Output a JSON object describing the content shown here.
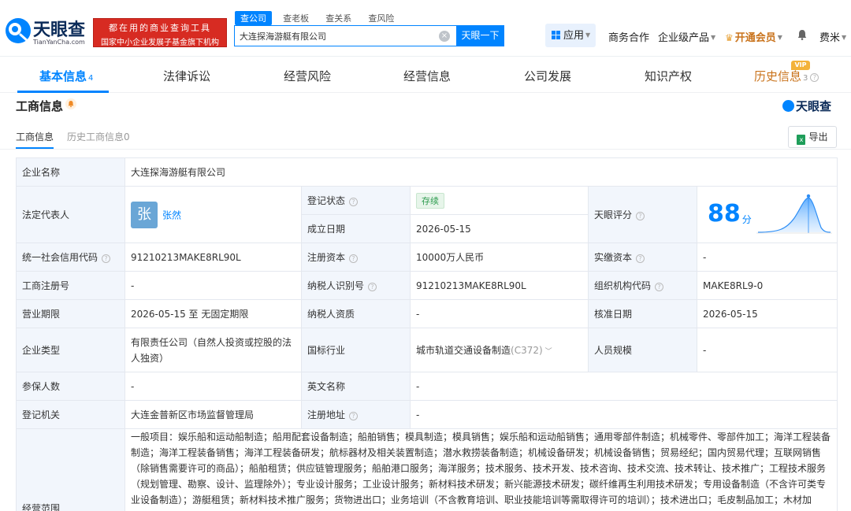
{
  "header": {
    "logo_cn": "天眼查",
    "logo_en": "TianYanCha.com",
    "ad_line1": "都在用的商业查询工具",
    "ad_line2": "国家中小企业发展子基金旗下机构",
    "search_tabs": [
      "查公司",
      "查老板",
      "查关系",
      "查风险"
    ],
    "search_value": "大连探海游艇有限公司",
    "search_button": "天眼一下",
    "app_button": "应用",
    "nav_business": "商务合作",
    "nav_enterprise": "企业级产品",
    "nav_vip": "开通会员",
    "user_name": "费米"
  },
  "main_tabs": {
    "basic": "基本信息",
    "basic_count": "4",
    "legal": "法律诉讼",
    "risk": "经营风险",
    "operation": "经营信息",
    "development": "公司发展",
    "ip": "知识产权",
    "history": "历史信息",
    "history_count": "3",
    "vip_badge": "VIP"
  },
  "section": {
    "title": "工商信息",
    "watermark": "天眼查",
    "sub_tab_current": "工商信息",
    "sub_tab_history": "历史工商信息",
    "sub_tab_history_count": "0",
    "export": "导出"
  },
  "table": {
    "company_name_label": "企业名称",
    "company_name": "大连探海游艇有限公司",
    "legal_rep_label": "法定代表人",
    "legal_rep_avatar": "张",
    "legal_rep_name": "张然",
    "reg_status_label": "登记状态",
    "reg_status": "存续",
    "found_date_label": "成立日期",
    "found_date": "2026-05-15",
    "score_label": "天眼评分",
    "score": "88",
    "score_unit": "分",
    "credit_code_label": "统一社会信用代码",
    "credit_code": "91210213MAKE8RL90L",
    "reg_capital_label": "注册资本",
    "reg_capital": "10000万人民币",
    "paid_capital_label": "实缴资本",
    "paid_capital": "-",
    "reg_no_label": "工商注册号",
    "reg_no": "-",
    "taxpayer_id_label": "纳税人识别号",
    "taxpayer_id": "91210213MAKE8RL90L",
    "org_code_label": "组织机构代码",
    "org_code": "MAKE8RL9-0",
    "term_label": "营业期限",
    "term": "2026-05-15 至 无固定期限",
    "taxpayer_qual_label": "纳税人资质",
    "taxpayer_qual": "-",
    "approve_date_label": "核准日期",
    "approve_date": "2026-05-15",
    "company_type_label": "企业类型",
    "company_type": "有限责任公司（自然人投资或控股的法人独资）",
    "industry_label": "国标行业",
    "industry": "城市轨道交通设备制造",
    "industry_code": "(C372)",
    "staff_size_label": "人员规模",
    "staff_size": "-",
    "insured_label": "参保人数",
    "insured": "-",
    "english_name_label": "英文名称",
    "english_name": "-",
    "reg_authority_label": "登记机关",
    "reg_authority": "大连金普新区市场监督管理局",
    "reg_address_label": "注册地址",
    "reg_address": "-",
    "scope_label": "经营范围",
    "scope": "一般项目：娱乐船和运动船制造；船用配套设备制造；船舶销售；模具制造；模具销售；娱乐船和运动船销售；通用零部件制造；机械零件、零部件加工；海洋工程装备制造；海洋工程装备销售；海洋工程装备研发；航标器材及相关装置制造；潜水救捞装备制造；机械设备研发；机械设备销售；贸易经纪；国内贸易代理；互联网销售（除销售需要许可的商品）；船舶租赁；供应链管理服务；船舶港口服务；海洋服务；技术服务、技术开发、技术咨询、技术交流、技术转让、技术推广；工程技术服务（规划管理、勘察、设计、监理除外）；专业设计服务；工业设计服务；新材料技术研发；新兴能源技术研发；碳纤维再生利用技术研发；专用设备制造（不含许可类专业设备制造）；游艇租赁；新材料技术推广服务；货物进出口；业务培训（不含教育培训、职业技能培训等需取得许可的培训）；技术进出口；毛皮制品加工；木材加"
  },
  "colors": {
    "accent": "#0084ff",
    "label_bg": "#f2f6fc",
    "status_green": "#2d9b4e",
    "ad_red": "#d72b22",
    "vip_orange": "#c9731c"
  },
  "icons": [
    "tianyancha-logo-icon",
    "clear-icon",
    "app-grid-icon",
    "crown-icon",
    "bell-icon",
    "help-icon",
    "excel-icon",
    "chevron-down-icon"
  ]
}
